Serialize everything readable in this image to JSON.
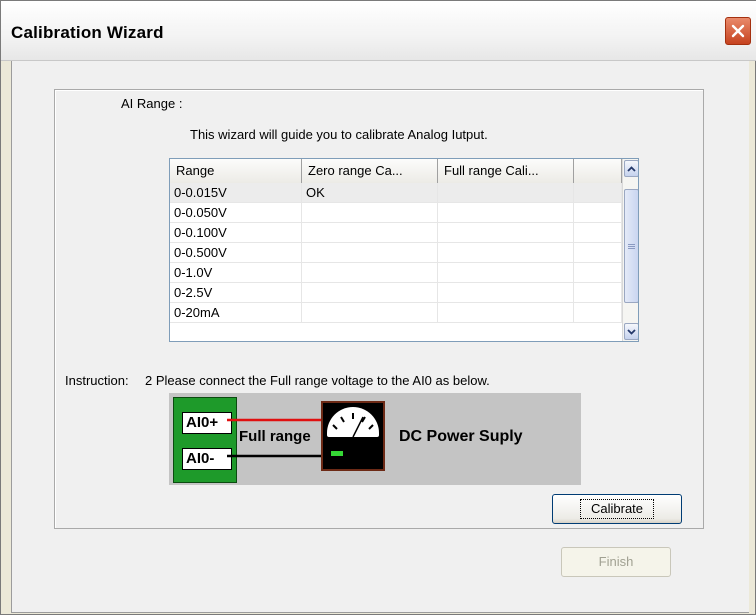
{
  "window": {
    "title": "Calibration Wizard"
  },
  "ai_range": {
    "label": "AI Range :"
  },
  "intro_text": "This wizard will guide you to calibrate Analog Iutput.",
  "table": {
    "columns": [
      "Range",
      "Zero range Ca...",
      "Full range Cali...",
      ""
    ],
    "rows": [
      [
        "0-0.015V",
        "OK",
        "",
        ""
      ],
      [
        "0-0.050V",
        "",
        "",
        ""
      ],
      [
        "0-0.100V",
        "",
        "",
        ""
      ],
      [
        "0-0.500V",
        "",
        "",
        ""
      ],
      [
        "0-1.0V",
        "",
        "",
        ""
      ],
      [
        "0-2.5V",
        "",
        "",
        ""
      ],
      [
        "0-20mA",
        "",
        "",
        ""
      ]
    ]
  },
  "instruction": {
    "label": "Instruction:",
    "text": "2 Please connect the Full range voltage to the AI0 as below."
  },
  "diagram": {
    "terminal_plus": "AI0+",
    "terminal_minus": "AI0-",
    "wire_label": "Full range",
    "device_label": "DC Power Suply"
  },
  "buttons": {
    "calibrate": "Calibrate",
    "finish": "Finish"
  },
  "colors": {
    "terminal_block": "#1e9a2a",
    "positive_wire": "#e01010",
    "negative_wire": "#000000",
    "close_button": "#c6421f"
  },
  "icons": {
    "close": "close-x-icon",
    "scroll_up": "scroll-up-arrow-icon",
    "scroll_down": "scroll-down-arrow-icon",
    "meter": "analog-meter-icon"
  }
}
